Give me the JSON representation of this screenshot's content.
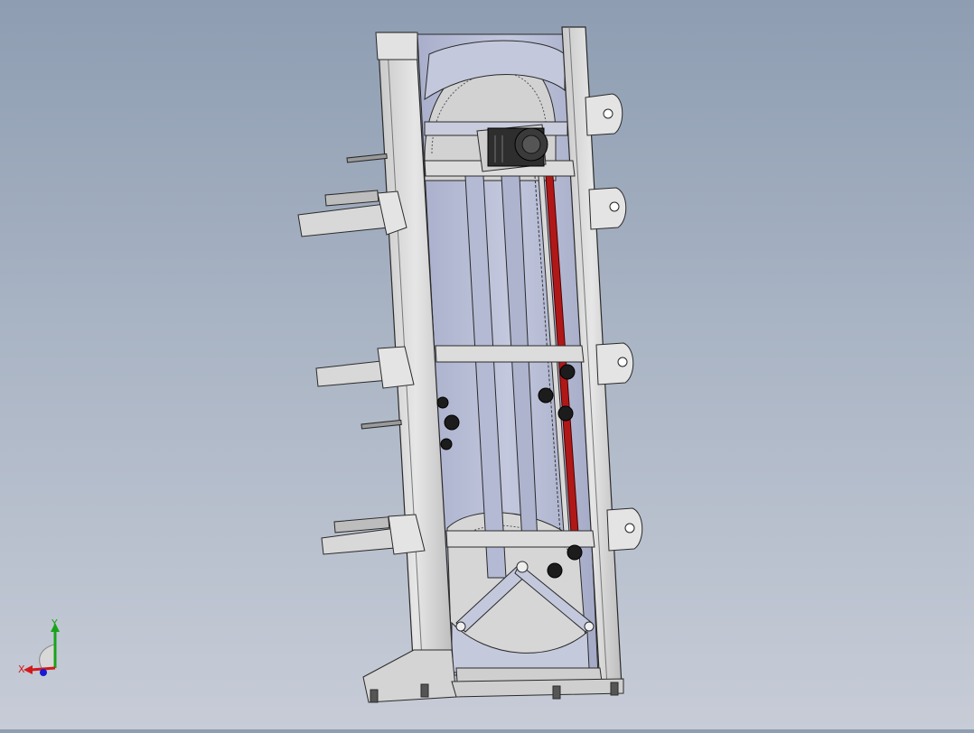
{
  "viewport": {
    "model": "conveyor-frame-assembly",
    "colors": {
      "frame": "#d9d9d9",
      "frame_edge": "#2a2a2a",
      "panel": "#b9bfd6",
      "panel_dark": "#9aa0bf",
      "gear": "#cfcfcf",
      "chain_red": "#b01818",
      "motor": "#2e2e2e",
      "roller": "#1c1c1c"
    }
  },
  "triad": {
    "x_label": "X",
    "y_label": "Y",
    "x_color": "#d11a1a",
    "y_color": "#1aa31a",
    "z_color": "#1a1ad1",
    "icon": "coordinate-triad-icon"
  }
}
